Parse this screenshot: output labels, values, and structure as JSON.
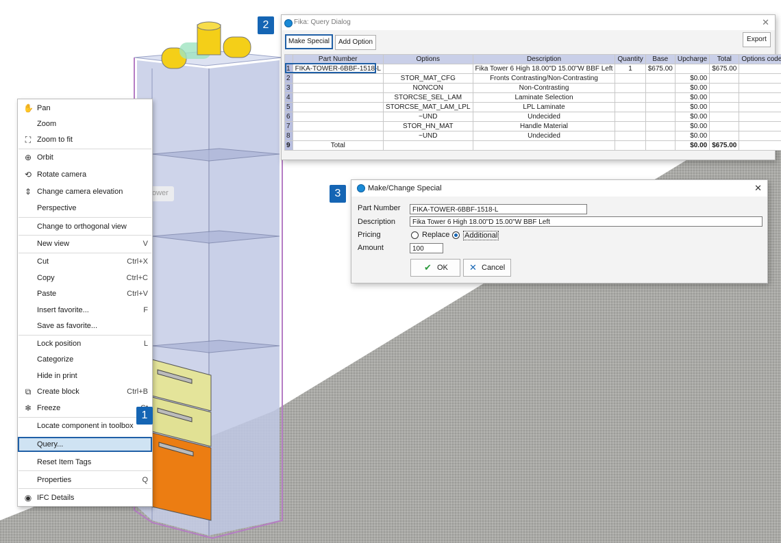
{
  "context_menu": {
    "items": [
      {
        "label": "Pan",
        "shortcut": "",
        "icon": "hand-icon"
      },
      {
        "label": "Zoom",
        "shortcut": "",
        "icon": ""
      },
      {
        "label": "Zoom to fit",
        "shortcut": "",
        "icon": "zoom-fit-icon"
      },
      {
        "label": "Orbit",
        "shortcut": "",
        "icon": "orbit-icon"
      },
      {
        "label": "Rotate camera",
        "shortcut": "",
        "icon": "rotate-camera-icon"
      },
      {
        "label": "Change camera elevation",
        "shortcut": "",
        "icon": "camera-elevation-icon"
      },
      {
        "label": "Perspective",
        "shortcut": "",
        "icon": ""
      },
      {
        "label": "Change to orthogonal view",
        "shortcut": "",
        "icon": ""
      },
      {
        "label": "New view",
        "shortcut": "V",
        "icon": ""
      },
      {
        "label": "Cut",
        "shortcut": "Ctrl+X",
        "icon": ""
      },
      {
        "label": "Copy",
        "shortcut": "Ctrl+C",
        "icon": ""
      },
      {
        "label": "Paste",
        "shortcut": "Ctrl+V",
        "icon": ""
      },
      {
        "label": "Insert favorite...",
        "shortcut": "F",
        "icon": ""
      },
      {
        "label": "Save as favorite...",
        "shortcut": "",
        "icon": ""
      },
      {
        "label": "Lock position",
        "shortcut": "L",
        "icon": ""
      },
      {
        "label": "Categorize",
        "shortcut": "",
        "icon": ""
      },
      {
        "label": "Hide in print",
        "shortcut": "",
        "icon": ""
      },
      {
        "label": "Create block",
        "shortcut": "Ctrl+B",
        "icon": "create-block-icon"
      },
      {
        "label": "Freeze",
        "shortcut": "Ct",
        "icon": "freeze-icon"
      },
      {
        "label": "Locate component in toolbox",
        "shortcut": "",
        "icon": ""
      },
      {
        "label": "Query...",
        "shortcut": "",
        "icon": ""
      },
      {
        "label": "Reset Item Tags",
        "shortcut": "",
        "icon": ""
      },
      {
        "label": "Properties",
        "shortcut": "Q",
        "icon": ""
      },
      {
        "label": "IFC Details",
        "shortcut": "",
        "icon": "ifc-icon"
      }
    ]
  },
  "scene": {
    "tower_label": "ower"
  },
  "badges": [
    "1",
    "2",
    "3"
  ],
  "query_dialog": {
    "title": "Fika: Query Dialog",
    "make_special": "Make Special",
    "add_option": "Add Option",
    "export": "Export",
    "columns": [
      "Part Number",
      "Options",
      "Description",
      "Quantity",
      "Base",
      "Upcharge",
      "Total",
      "Options code"
    ],
    "rows": [
      {
        "n": "1",
        "part": "FIKA-TOWER-6BBF-1518-L",
        "opt": "",
        "desc": "Fika Tower 6 High 18.00\"D 15.00\"W BBF Left",
        "qty": "1",
        "base": "$675.00",
        "up": "",
        "total": "$675.00",
        "code": ""
      },
      {
        "n": "2",
        "part": "",
        "opt": "STOR_MAT_CFG",
        "desc": "Fronts Contrasting/Non-Contrasting",
        "qty": "",
        "base": "",
        "up": "$0.00",
        "total": "",
        "code": ""
      },
      {
        "n": "3",
        "part": "",
        "opt": "NONCON",
        "desc": "Non-Contrasting",
        "qty": "",
        "base": "",
        "up": "$0.00",
        "total": "",
        "code": ""
      },
      {
        "n": "4",
        "part": "",
        "opt": "STORCSE_SEL_LAM",
        "desc": "Laminate Selection",
        "qty": "",
        "base": "",
        "up": "$0.00",
        "total": "",
        "code": ""
      },
      {
        "n": "5",
        "part": "",
        "opt": "STORCSE_MAT_LAM_LPL",
        "desc": "LPL Laminate",
        "qty": "",
        "base": "",
        "up": "$0.00",
        "total": "",
        "code": ""
      },
      {
        "n": "6",
        "part": "",
        "opt": "~UND",
        "desc": "Undecided",
        "qty": "",
        "base": "",
        "up": "$0.00",
        "total": "",
        "code": ""
      },
      {
        "n": "7",
        "part": "",
        "opt": "STOR_HN_MAT",
        "desc": "Handle Material",
        "qty": "",
        "base": "",
        "up": "$0.00",
        "total": "",
        "code": ""
      },
      {
        "n": "8",
        "part": "",
        "opt": "~UND",
        "desc": "Undecided",
        "qty": "",
        "base": "",
        "up": "$0.00",
        "total": "",
        "code": ""
      }
    ],
    "total_row": {
      "n": "9",
      "part": "Total",
      "up": "$0.00",
      "total": "$675.00"
    }
  },
  "special_dialog": {
    "title": "Make/Change Special",
    "part_number_label": "Part Number",
    "part_number_value": "FIKA-TOWER-6BBF-1518-L",
    "description_label": "Description",
    "description_value": "Fika Tower 6 High 18.00\"D 15.00\"W BBF Left",
    "pricing_label": "Pricing",
    "replace_label": "Replace",
    "additional_label": "Additional",
    "pricing_selected": "Additional",
    "amount_label": "Amount",
    "amount_value": "100",
    "ok_label": "OK",
    "cancel_label": "Cancel"
  }
}
